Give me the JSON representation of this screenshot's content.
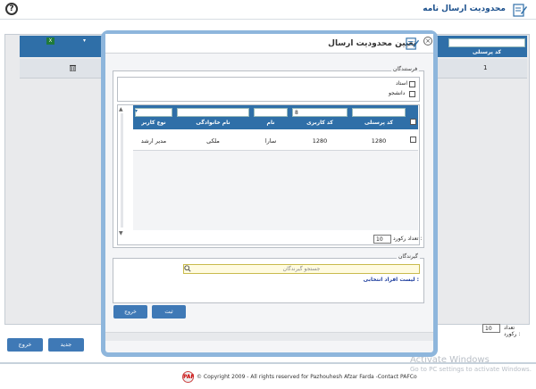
{
  "header": {
    "title": "محدودیت ارسال نامه",
    "help_icon": "question-circle-icon",
    "title_icon": "edit-document-icon"
  },
  "background": {
    "column_header": "کد پرسنلی",
    "row_value": "1",
    "delete_icon": "trash-icon",
    "excel_icon": "excel-icon",
    "pager_label": "تعداد رکورد :",
    "pager_value": "10",
    "new_button": "جدید",
    "exit_button": "خروج"
  },
  "dialog": {
    "title": "تعیین محدودیت ارسال",
    "senders_legend": "فرستندگان",
    "option_teacher": "استاد",
    "option_student": "دانشجو",
    "grid": {
      "columns": [
        "کد پرسنلی",
        "کد کاربری",
        "نام",
        "نام خانوادگی",
        "نوع کاربر"
      ],
      "filter_value_user_code": "8",
      "rows": [
        [
          "1280",
          "1280",
          "سارا",
          "ملکی",
          "مدیر ارشد"
        ]
      ]
    },
    "pager_label": "تعداد رکورد :",
    "pager_value": "10",
    "receivers_legend": "گیرندگان",
    "search_placeholder": "جستجو گیرندگان",
    "selected_label": "لیست افراد انتخابی :",
    "submit_button": "ثبت",
    "exit_button": "خروج"
  },
  "footer": {
    "text": "© Copyright 2009 - All rights reserved for Pazhouhesh Afzar Farda -Contact PAFCo",
    "logo_text": "PAF"
  },
  "watermark": {
    "line1": "Activate Windows",
    "line2": "Go to PC settings to activate Windows."
  },
  "colors": {
    "primary": "#2f6fa8",
    "button": "#3f79b6",
    "dialog_frame": "#8eb6dc"
  }
}
